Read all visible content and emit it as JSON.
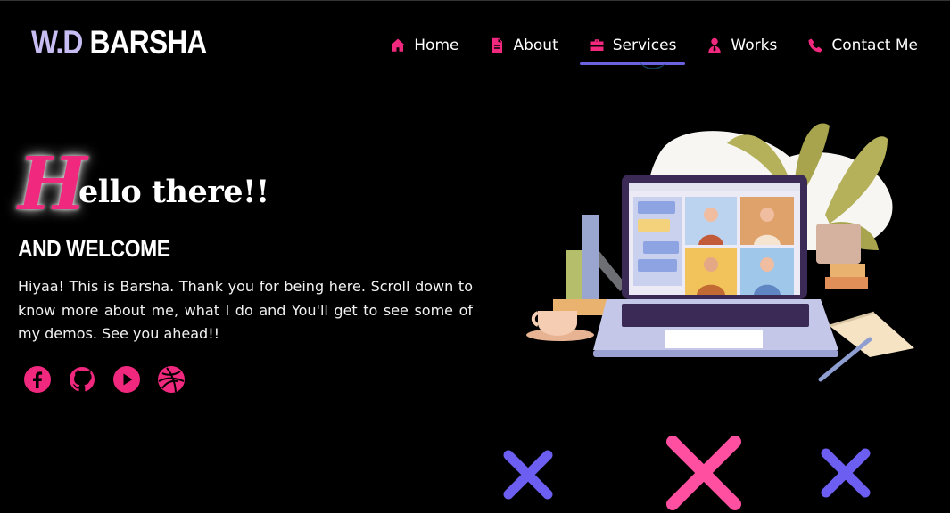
{
  "brand": {
    "part1": "W.D",
    "part2": "BARSHA"
  },
  "nav": [
    {
      "label": "Home",
      "icon": "home-icon",
      "active": false
    },
    {
      "label": "About",
      "icon": "document-icon",
      "active": false
    },
    {
      "label": "Services",
      "icon": "briefcase-icon",
      "active": true
    },
    {
      "label": "Works",
      "icon": "user-tie-icon",
      "active": false
    },
    {
      "label": "Contact Me",
      "icon": "phone-icon",
      "active": false
    }
  ],
  "hero": {
    "hello_initial": "H",
    "hello_rest": "ello there!!",
    "welcome": "AND WELCOME",
    "intro": "Hiyaa! This is Barsha. Thank you for being here. Scroll down to know more about me, what I do and You'll get to see some of my demos. See you ahead!!"
  },
  "socials": [
    "facebook-icon",
    "github-icon",
    "youtube-icon",
    "dribbble-icon"
  ],
  "colors": {
    "accent": "#f0287e",
    "purple": "#6b62e0",
    "brand_light": "#c8bdf2",
    "cross_pink": "#ff4fa0",
    "cross_purple": "#6b5ef0"
  }
}
